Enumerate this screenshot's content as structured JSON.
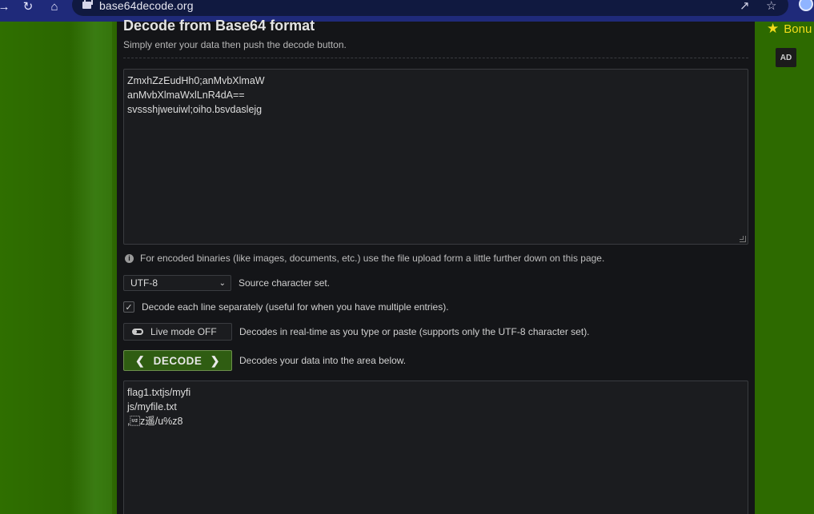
{
  "browser": {
    "url": "base64decode.org",
    "back_icon": "arrow-right-icon",
    "reload_icon": "reload-icon",
    "home_icon": "home-icon"
  },
  "sidebar_right": {
    "bonus_label": "Bonu",
    "ad_label": "AD"
  },
  "main": {
    "title": "Decode from Base64 format",
    "subtitle": "Simply enter your data then push the decode button.",
    "input_lines": [
      "ZmxhZzEudHh0;anMvbXlmaW",
      "anMvbXlmaWxlLnR4dA==",
      "svssshjweuiwl;oiho.bsvdaslejg"
    ],
    "info_text": "For encoded binaries (like images, documents, etc.) use the file upload form a little further down on this page.",
    "charset": {
      "selected": "UTF-8",
      "label": "Source character set."
    },
    "decode_each_line": {
      "checked": true,
      "label": "Decode each line separately (useful for when you have multiple entries)."
    },
    "live_mode": {
      "button_label": "Live mode OFF",
      "description": "Decodes in real-time as you type or paste (supports only the UTF-8 character set)."
    },
    "decode": {
      "button_label": "DECODE",
      "description": "Decodes your data into the area below."
    },
    "output_lines": [
      "flag1.txtjs/myfi",
      "js/myfile.txt",
      ",\u001fz遥/u%z8"
    ]
  },
  "colors": {
    "page_bg": "#2d6a00",
    "panel_bg": "#141518",
    "accent_green": "#2f5d12",
    "bonus_yellow": "#f2dc1a"
  }
}
